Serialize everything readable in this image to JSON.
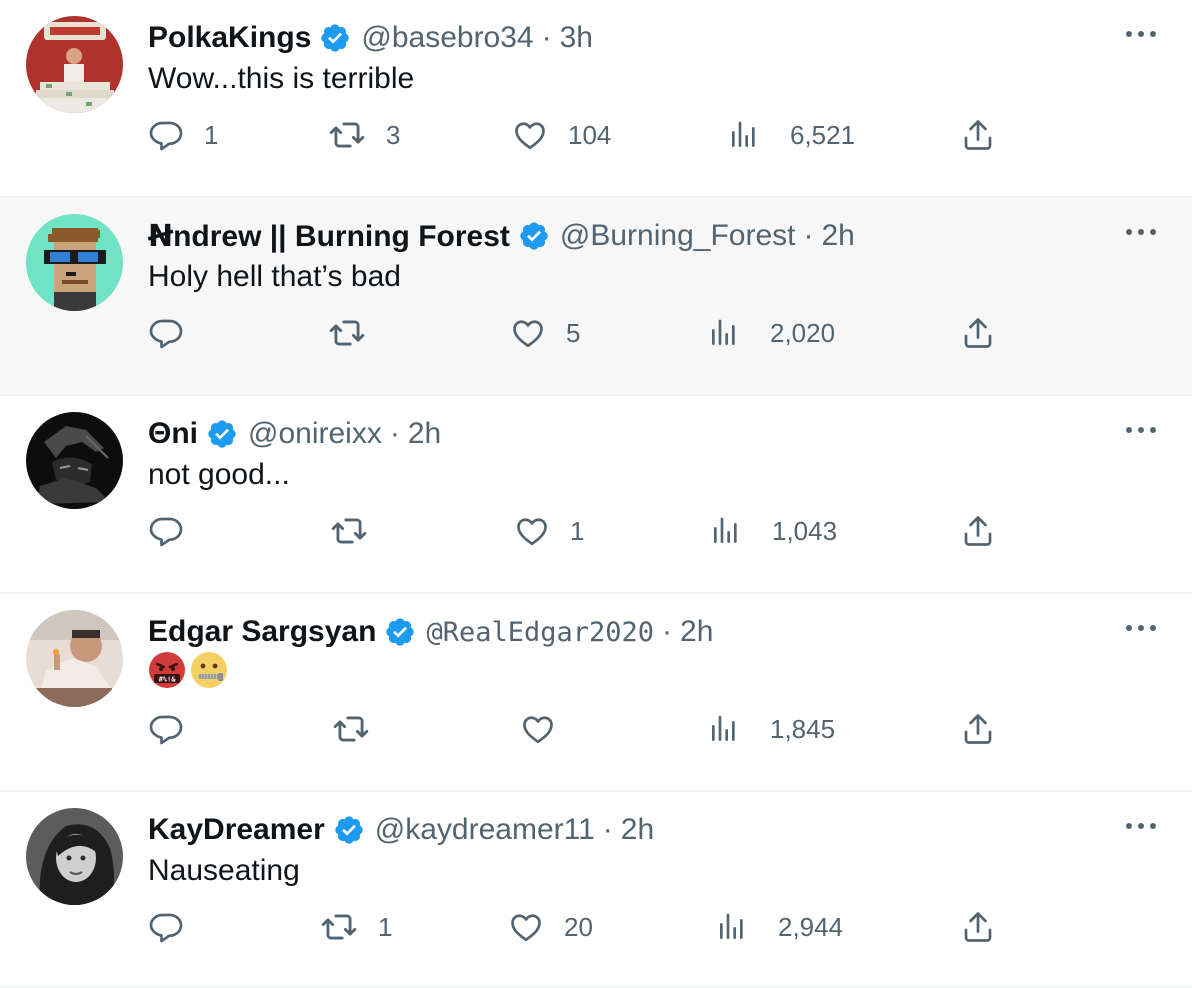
{
  "colors": {
    "verified": "#1d9bf0",
    "text": "#0f1419",
    "muted": "#536471",
    "separator": "#eff3f4"
  },
  "icons": {
    "more": "more-horizontal-icon",
    "reply": "reply-bubble-icon",
    "retweet": "retweet-icon",
    "like": "heart-icon",
    "views": "views-bar-chart-icon",
    "share": "share-upload-icon",
    "verified": "verified-badge-icon"
  },
  "tweets": [
    {
      "name": "PolkaKings",
      "handle": "@basebro34",
      "sep": "·",
      "time": "3h",
      "text": "Wow...this is terrible",
      "replies": "1",
      "retweets": "3",
      "likes": "104",
      "views": "6,521"
    },
    {
      "name": "Ꞥndrew || Burning Forest",
      "handle": "@Burning_Forest",
      "sep": "·",
      "time": "2h",
      "text": "Holy hell that’s bad",
      "replies": "",
      "retweets": "",
      "likes": "5",
      "views": "2,020"
    },
    {
      "name": "Θni",
      "handle": "@onireixx",
      "sep": "·",
      "time": "2h",
      "text": "not good...",
      "replies": "",
      "retweets": "",
      "likes": "1",
      "views": "1,043"
    },
    {
      "name": "Edgar Sargsyan",
      "handle": "@RealEdgar2020",
      "sep": "·",
      "time": "2h",
      "text": "",
      "emojis": [
        "face-with-symbols-on-mouth-emoji",
        "zipper-mouth-face-emoji"
      ],
      "replies": "",
      "retweets": "",
      "likes": "",
      "views": "1,845"
    },
    {
      "name": "KayDreamer",
      "handle": "@kaydreamer11",
      "sep": "·",
      "time": "2h",
      "text": "Nauseating",
      "replies": "",
      "retweets": "1",
      "likes": "20",
      "views": "2,944"
    }
  ]
}
